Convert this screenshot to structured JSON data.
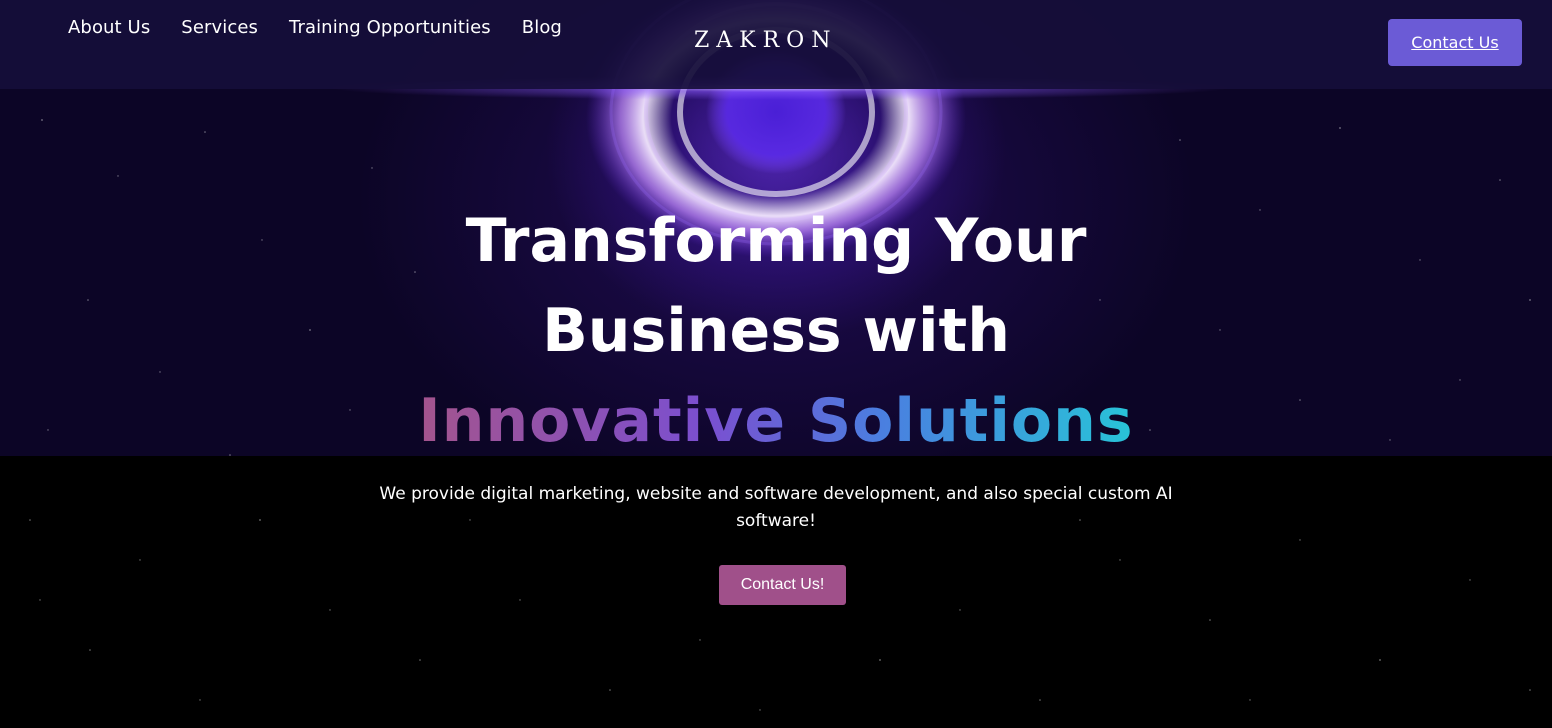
{
  "header": {
    "nav": [
      {
        "label": "About Us"
      },
      {
        "label": "Services"
      },
      {
        "label": "Training Opportunities"
      },
      {
        "label": "Blog"
      }
    ],
    "logo": "ZAKRON",
    "contact_label": "Contact Us"
  },
  "hero": {
    "headline_line1": "Transforming Your",
    "headline_line2": "Business with",
    "headline_highlight": "Innovative Solutions",
    "subtitle": "We provide digital marketing, website and software development, and also special custom AI software!",
    "cta_label": "Contact Us!"
  },
  "colors": {
    "header_button": "#6b5bd6",
    "cta_button": "#a0508a",
    "hero_background": "#0c0526",
    "page_background": "#000000",
    "gradient_start": "#a4548d",
    "gradient_end": "#28c4d8"
  }
}
